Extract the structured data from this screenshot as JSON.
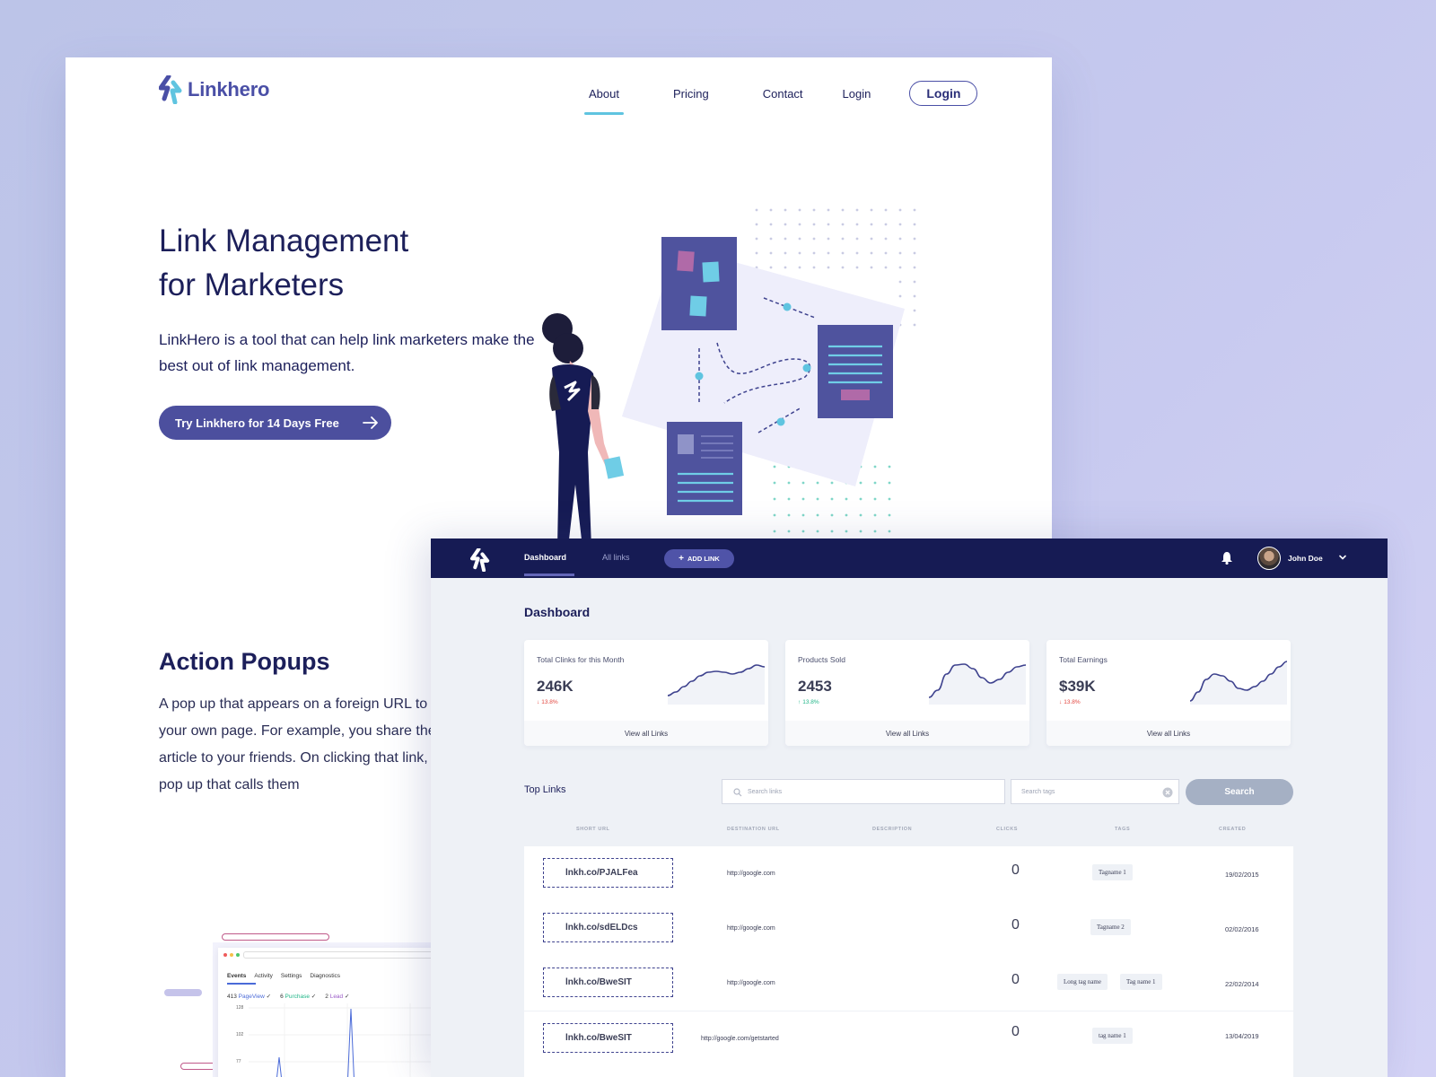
{
  "landing": {
    "brand": "Linkhero",
    "nav": [
      "About",
      "Pricing",
      "Contact",
      "Login"
    ],
    "login_button": "Login",
    "hero_title_1": "Link Management",
    "hero_title_2": "for Marketers",
    "hero_subtitle": "LinkHero is a tool that can help link marketers make the best out of link management.",
    "cta": "Try Linkhero for 14 Days Free",
    "section_title": "Action Popups",
    "section_body": "A pop up that appears on a foreign URL to redirect users to your own page. For example, you share the link of a viral article to your friends. On clicking that link, user will see a pop up that calls them",
    "mini_preview": {
      "tabs": [
        "Events",
        "Activity",
        "Settings",
        "Diagnostics"
      ],
      "events": [
        {
          "count": "413",
          "name": "PageView",
          "color": "#4a6ad8"
        },
        {
          "count": "6",
          "name": "Purchase",
          "color": "#1fb587"
        },
        {
          "count": "2",
          "name": "Lead",
          "color": "#9b5cc8"
        }
      ],
      "y_ticks": [
        "128",
        "102",
        "77"
      ]
    }
  },
  "dashboard": {
    "nav_tabs": [
      "Dashboard",
      "All links"
    ],
    "add_link": "ADD LINK",
    "user_name": "John Doe",
    "title": "Dashboard",
    "stats": [
      {
        "label": "Total Clinks for this Month",
        "value": "246K",
        "delta": "13.8%",
        "direction": "down",
        "footer": "View all Links",
        "spark": [
          38,
          34,
          28,
          22,
          16,
          12,
          11,
          12,
          14,
          12,
          8,
          4,
          6
        ]
      },
      {
        "label": "Products Sold",
        "value": "2453",
        "delta": "13.8%",
        "direction": "up",
        "footer": "View all Links",
        "spark": [
          40,
          32,
          14,
          4,
          3,
          8,
          18,
          24,
          20,
          12,
          6,
          4
        ]
      },
      {
        "label": "Total Earnings",
        "value": "$39K",
        "delta": "13.8%",
        "direction": "down",
        "footer": "View all Links",
        "spark": [
          44,
          34,
          20,
          14,
          16,
          22,
          30,
          32,
          28,
          22,
          14,
          6,
          0
        ]
      }
    ],
    "top_links_title": "Top Links",
    "search_placeholder": "Search links",
    "tags_placeholder": "Search tags",
    "search_button": "Search",
    "columns": [
      "SHORT URL",
      "DESTINATION URL",
      "DESCRIPTION",
      "CLICKS",
      "TAGS",
      "CREATED"
    ],
    "rows": [
      {
        "short": "lnkh.co/PJALFea",
        "dest": "http://google.com",
        "clicks": "0",
        "tags": [
          "Tagname 1"
        ],
        "created": "19/02/2015"
      },
      {
        "short": "lnkh.co/sdELDcs",
        "dest": "http://google.com",
        "clicks": "0",
        "tags": [
          "Tagname 2"
        ],
        "created": "02/02/2016"
      },
      {
        "short": "lnkh.co/BweSIT",
        "dest": "http://google.com",
        "clicks": "0",
        "tags": [
          "Long tag name",
          "Tag name 1"
        ],
        "created": "22/02/2014"
      },
      {
        "short": "lnkh.co/BweSIT",
        "dest": "http://google.com/getstarted",
        "clicks": "0",
        "tags": [
          "tag name 1"
        ],
        "created": "13/04/2019"
      }
    ]
  },
  "colors": {
    "brand": "#4a4fa6",
    "navy": "#161b54",
    "accent": "#5fc4e0",
    "down": "#e2463f",
    "up": "#1fb587"
  }
}
